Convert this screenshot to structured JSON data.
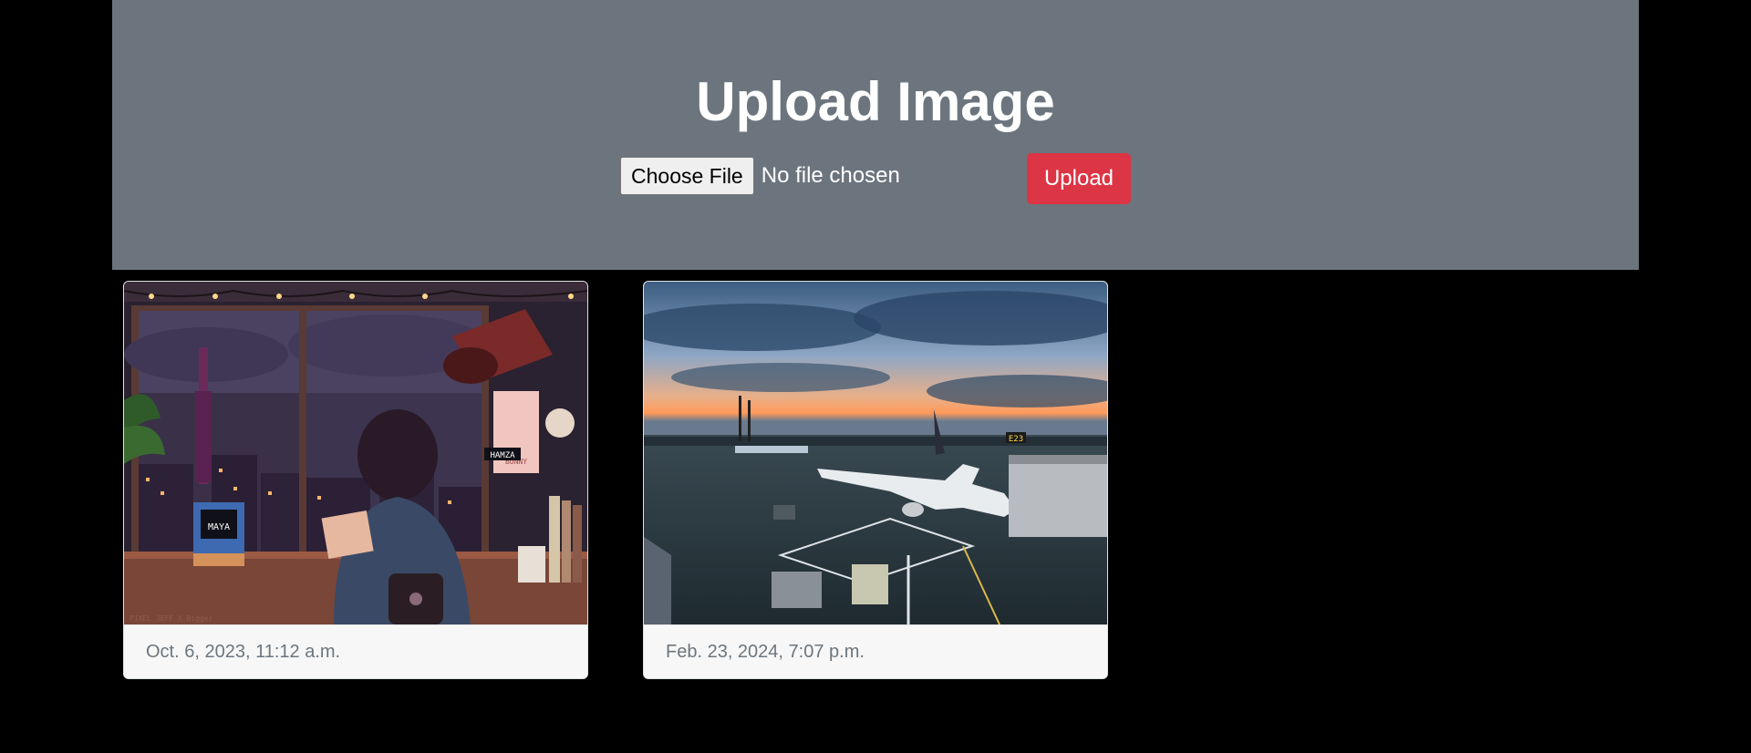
{
  "upload": {
    "title": "Upload Image",
    "choose_file_label": "Choose File",
    "file_status": "No file chosen",
    "upload_label": "Upload"
  },
  "cards": [
    {
      "timestamp": "Oct. 6, 2023, 11:12 a.m.",
      "image_subject": "pixel-art girl at desk by rainy city window",
      "sign_left": "MAYA",
      "sign_right": "HAMZA",
      "poster_text": "BUNNY",
      "watermark": "PIXEL JEFF X Bigger"
    },
    {
      "timestamp": "Feb. 23, 2024, 7:07 p.m.",
      "image_subject": "airplane at airport gate at sunset",
      "gate_sign": "E23"
    }
  ],
  "colors": {
    "panel": "#6c757d",
    "upload_button": "#dc3545",
    "background": "#000000",
    "card_footer": "#f7f7f7",
    "footer_text": "#6c757d"
  }
}
